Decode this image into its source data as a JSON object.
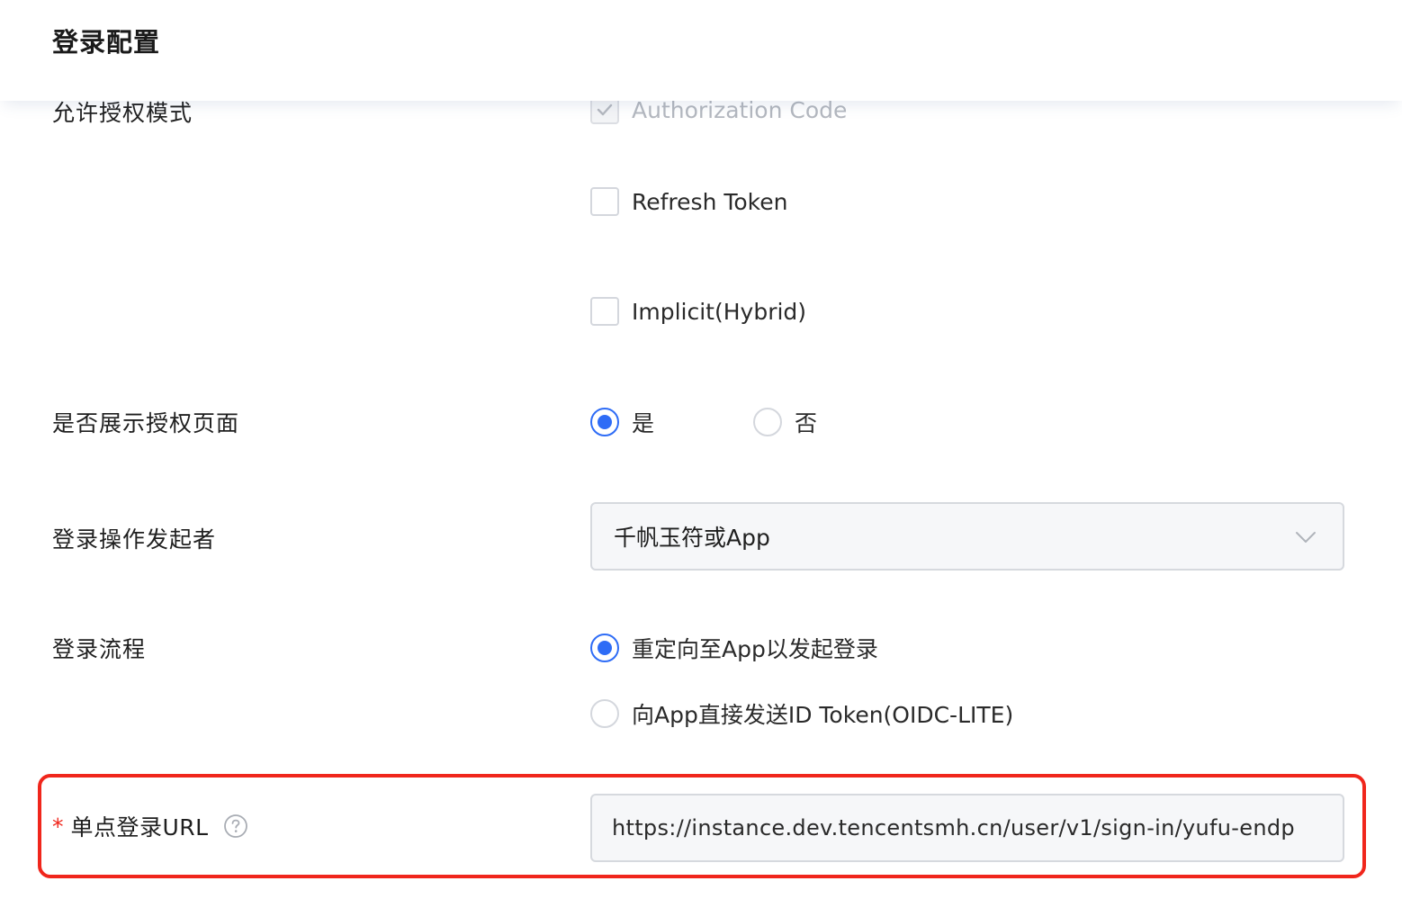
{
  "header": {
    "title": "登录配置"
  },
  "grant_modes": {
    "label": "允许授权模式",
    "options": [
      {
        "label": "Authorization Code",
        "checked": true,
        "disabled": true
      },
      {
        "label": "Refresh Token",
        "checked": false,
        "disabled": false
      },
      {
        "label": "Implicit(Hybrid)",
        "checked": false,
        "disabled": false
      }
    ]
  },
  "show_auth_page": {
    "label": "是否展示授权页面",
    "options": [
      {
        "label": "是",
        "selected": true
      },
      {
        "label": "否",
        "selected": false
      }
    ]
  },
  "login_initiator": {
    "label": "登录操作发起者",
    "value": "千帆玉符或App"
  },
  "login_flow": {
    "label": "登录流程",
    "options": [
      {
        "label": "重定向至App以发起登录",
        "selected": true
      },
      {
        "label": "向App直接发送ID Token(OIDC-LITE)",
        "selected": false
      }
    ]
  },
  "sso_url": {
    "required_mark": "*",
    "label": "单点登录URL",
    "value": "https://instance.dev.tencentsmh.cn/user/v1/sign-in/yufu-endp"
  },
  "colors": {
    "accent": "#2e6cf6",
    "highlight": "#f0261c"
  }
}
